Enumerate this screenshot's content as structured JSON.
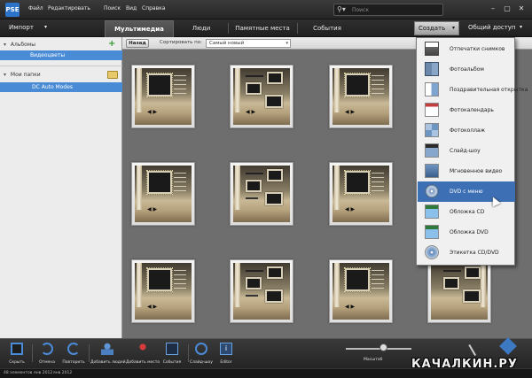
{
  "menubar": {
    "logo": "PSE",
    "items": [
      "Файл",
      "Редактировать",
      "Поиск",
      "Вид",
      "Справка"
    ],
    "search_placeholder": "Поиск",
    "search_icon": "search-icon"
  },
  "modebar": {
    "import_label": "Импорт",
    "tabs": [
      "Мультимедиа",
      "Люди",
      "Памятные места",
      "События"
    ],
    "active_tab": "Мультимедиа",
    "create_label": "Создать",
    "share_label": "Общий доступ"
  },
  "left_panel": {
    "albums_header": "Альбомы",
    "selected_album": "Видеоцветы",
    "folders_header": "Мои папки",
    "selected_folder": "DC Auto Modes"
  },
  "content_header": {
    "back_label": "Назад",
    "sort_label": "Сортировать по:",
    "sort_value": "Самый новый"
  },
  "create_menu": {
    "items": [
      {
        "label": "Отпечатки снимков",
        "icon": "printer-icon"
      },
      {
        "label": "Фотоальбом",
        "icon": "photo-book-icon"
      },
      {
        "label": "Поздравительная открытка",
        "icon": "greeting-card-icon"
      },
      {
        "label": "Фотокалендарь",
        "icon": "photo-calendar-icon"
      },
      {
        "label": "Фотоколлаж",
        "icon": "photo-collage-icon"
      },
      {
        "label": "Слайд-шоу",
        "icon": "slideshow-icon"
      },
      {
        "label": "Мгновенное видео",
        "icon": "instant-movie-icon"
      },
      {
        "label": "DVD с меню",
        "icon": "dvd-with-menu-icon"
      },
      {
        "label": "Обложка CD",
        "icon": "cd-jacket-icon"
      },
      {
        "label": "Обложка DVD",
        "icon": "dvd-jacket-icon"
      },
      {
        "label": "Этикетка CD/DVD",
        "icon": "cd-dvd-label-icon"
      }
    ],
    "highlighted": "DVD с меню"
  },
  "bottom_toolbar": {
    "buttons": [
      {
        "label": "Скрыть",
        "icon": "hide-panel-icon"
      },
      {
        "label": "Отмена",
        "icon": "undo-icon"
      },
      {
        "label": "Повторить",
        "icon": "redo-icon"
      },
      {
        "label": "Добавить людей",
        "icon": "add-people-icon"
      },
      {
        "label": "Добавить место",
        "icon": "add-place-icon"
      },
      {
        "label": "События",
        "icon": "add-event-icon"
      },
      {
        "label": "Слайд-шоу",
        "icon": "slideshow-play-icon"
      },
      {
        "label": "Editor",
        "icon": "editor-icon"
      }
    ],
    "zoom_label": "Масштаб"
  },
  "statusbar": {
    "items_text": "48 элементов",
    "date_from": "янв 2012",
    "date_to": "янв 2012"
  },
  "watermark": "КАЧАЛКИН.РУ",
  "colors": {
    "accent": "#4a8bd6",
    "menu_highlight": "#3d6fb4",
    "grid_background": "#6e6e6e"
  }
}
